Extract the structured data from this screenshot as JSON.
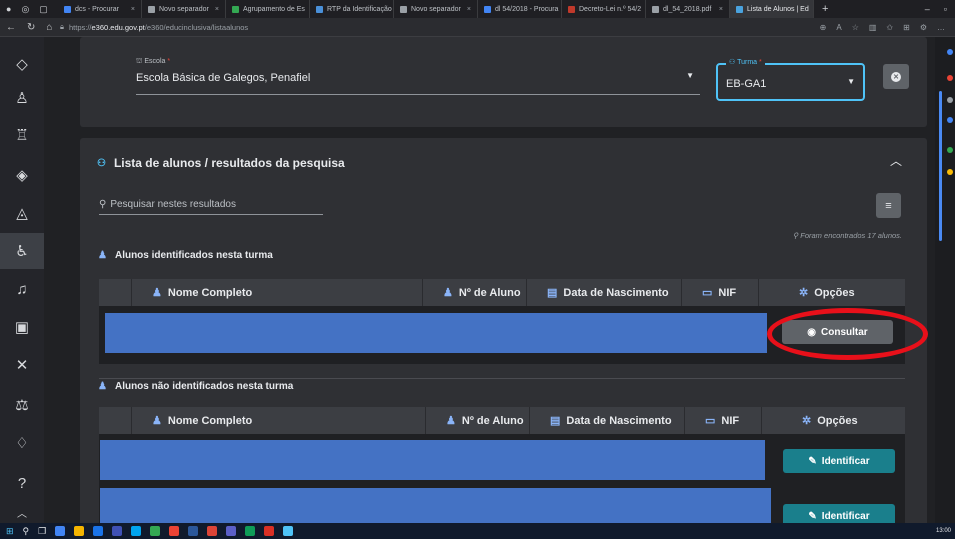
{
  "browser": {
    "tabs": [
      {
        "label": "dcs - Procurar",
        "color": "#4285f4"
      },
      {
        "label": "Novo separador",
        "color": "#9aa0a6"
      },
      {
        "label": "Agrupamento de Es",
        "color": "#34a853"
      },
      {
        "label": "RTP da Identificação",
        "color": "#4a90d9"
      },
      {
        "label": "Novo separador",
        "color": "#9aa0a6"
      },
      {
        "label": "dl 54/2018 - Procura",
        "color": "#4285f4"
      },
      {
        "label": "Decreto-Lei n.º 54/2",
        "color": "#c0392b"
      },
      {
        "label": "dl_54_2018.pdf",
        "color": "#9aa0a6"
      },
      {
        "label": "Lista de Alunos | Ed",
        "color": "#4aa3df"
      }
    ],
    "url_prefix": "https://",
    "url_host": "e360.edu.gov.pt",
    "url_path": "/e360/educinclusiva/listaalunos"
  },
  "filters": {
    "escola_label": "Escola",
    "escola_required": "*",
    "escola_value": "Escola Básica de Galegos, Penafiel",
    "turma_label": "Turma",
    "turma_required": "*",
    "turma_value": "EB-GA1"
  },
  "panel": {
    "title": "Lista de alunos / resultados da pesquisa",
    "search_placeholder": "Pesquisar nestes resultados",
    "results_count": "Foram encontrados 17 alunos."
  },
  "identified": {
    "title": "Alunos identificados nesta turma",
    "columns": [
      "Nome Completo",
      "Nº de Aluno",
      "Data de Nascimento",
      "NIF",
      "Opções"
    ],
    "action_label": "Consultar"
  },
  "unidentified": {
    "title": "Alunos não identificados nesta turma",
    "columns": [
      "Nome Completo",
      "Nº de Aluno",
      "Data de Nascimento",
      "NIF",
      "Opções"
    ],
    "action_label": "Identificar"
  },
  "taskbar": {
    "time": "13:00"
  },
  "colors": {
    "redaction": "#4472c4",
    "highlight_circle": "#e8101a",
    "teal_button": "#1a7f8c",
    "turma_border": "#4fc3f7"
  }
}
